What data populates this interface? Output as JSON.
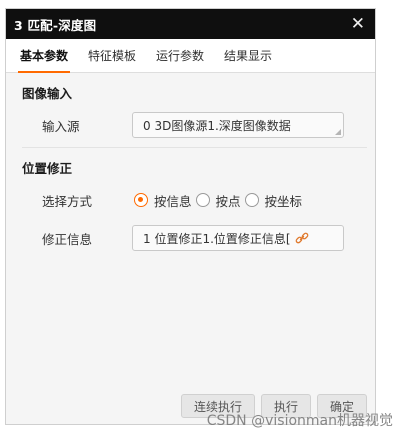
{
  "window": {
    "title": "3 匹配-深度图",
    "close_glyph": "✕"
  },
  "tabs": [
    {
      "label": "基本参数",
      "active": true
    },
    {
      "label": "特征模板",
      "active": false
    },
    {
      "label": "运行参数",
      "active": false
    },
    {
      "label": "结果显示",
      "active": false
    }
  ],
  "image_input": {
    "section_title": "图像输入",
    "source_label": "输入源",
    "source_value": "0 3D图像源1.深度图像数据"
  },
  "position_correction": {
    "section_title": "位置修正",
    "method_label": "选择方式",
    "options": [
      {
        "label": "按信息",
        "checked": true
      },
      {
        "label": "按点",
        "checked": false
      },
      {
        "label": "按坐标",
        "checked": false
      }
    ],
    "info_label": "修正信息",
    "info_value": "1 位置修正1.位置修正信息["
  },
  "footer": {
    "buttons": [
      "连续执行",
      "执行",
      "确定"
    ]
  },
  "watermark": "CSDN @visionman机器视觉",
  "colors": {
    "accent": "#ff6a00",
    "titlebar": "#0f0f0f"
  }
}
